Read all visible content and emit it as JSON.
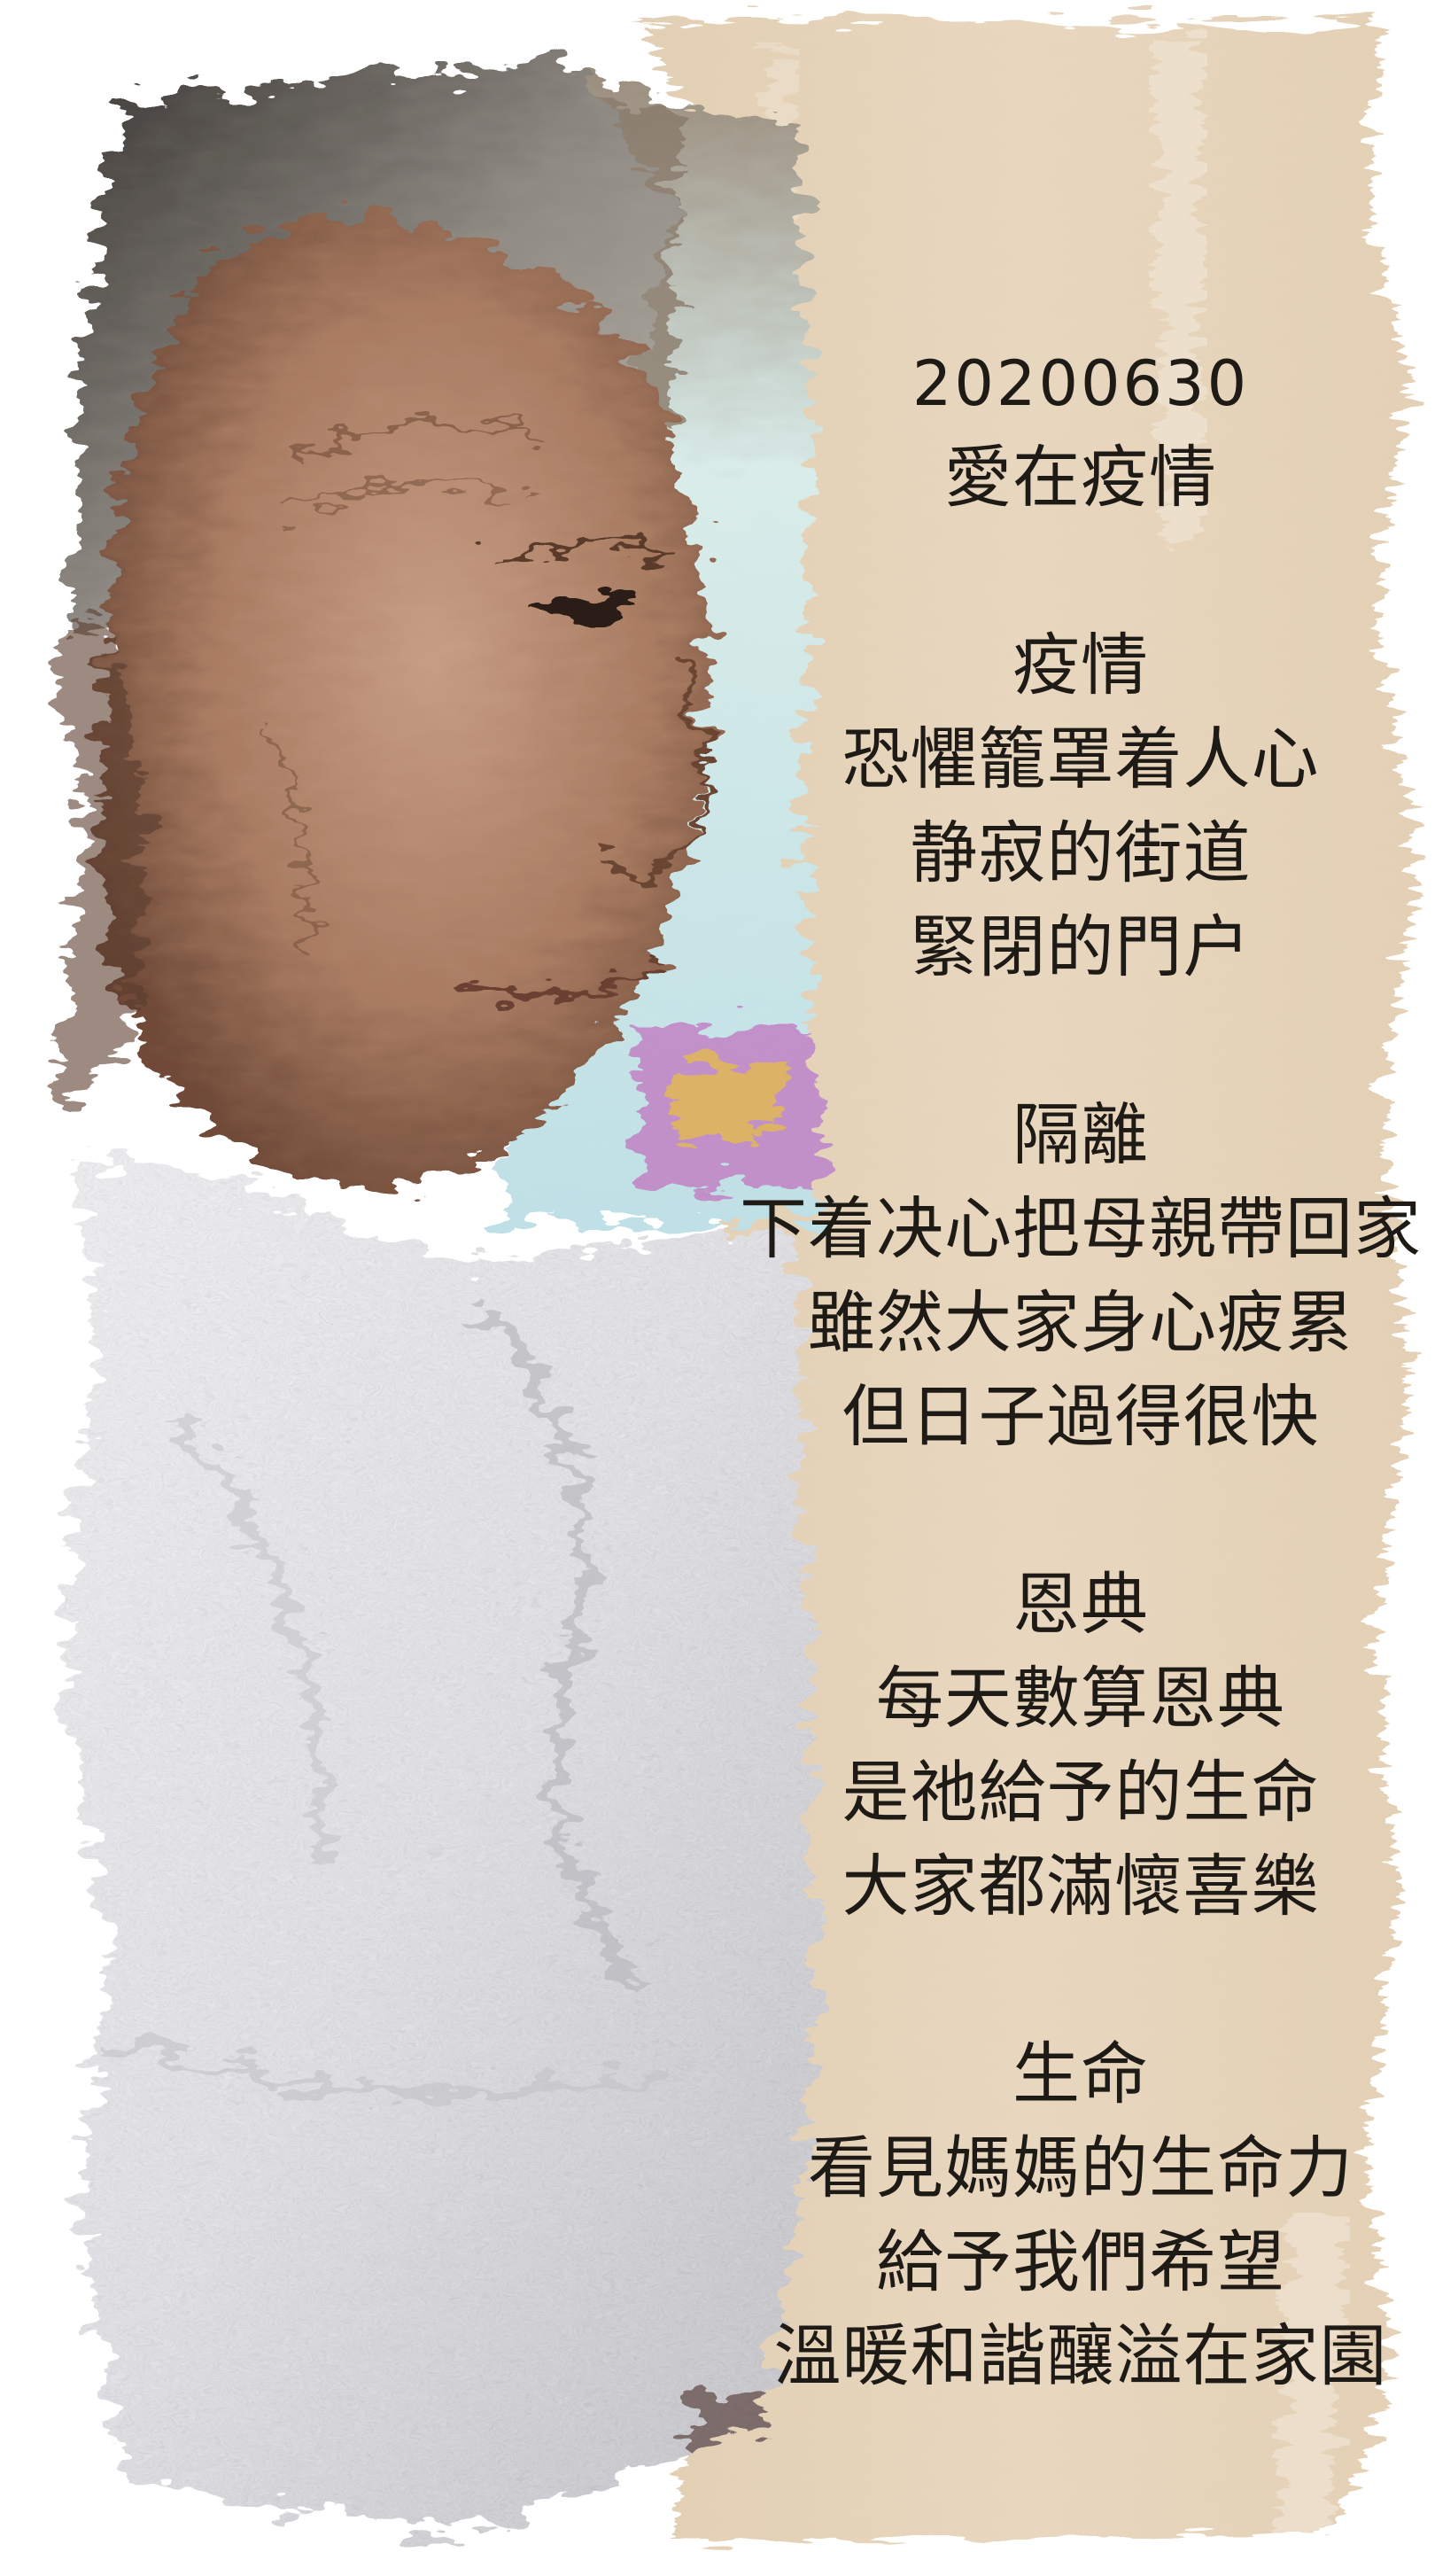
{
  "colors": {
    "brush": "#e6d4bb",
    "brush_light": "#efe3d1",
    "text": "#1e1a16",
    "towel": "#eeeef0",
    "skin": "#b48a6e",
    "hair": "#8d8880",
    "window": "#cfe6ea"
  },
  "poem": {
    "date": "20200630",
    "title": "愛在疫情",
    "stanzas": [
      {
        "heading": "疫情",
        "lines": [
          "恐懼籠罩着人心",
          "静寂的街道",
          "緊閉的門户"
        ]
      },
      {
        "heading": "隔離",
        "lines": [
          "下着决心把母親帶回家",
          "雖然大家身心疲累",
          "但日子過得很快"
        ]
      },
      {
        "heading": "恩典",
        "lines": [
          "每天數算恩典",
          "是祂給予的生命",
          "大家都滿懷喜樂"
        ]
      },
      {
        "heading": "生命",
        "lines": [
          "看見媽媽的生命力",
          "給予我們希望",
          "溫暖和諧釀溢在家園"
        ]
      }
    ]
  },
  "image": {
    "subject": "elderly-woman-portrait"
  }
}
